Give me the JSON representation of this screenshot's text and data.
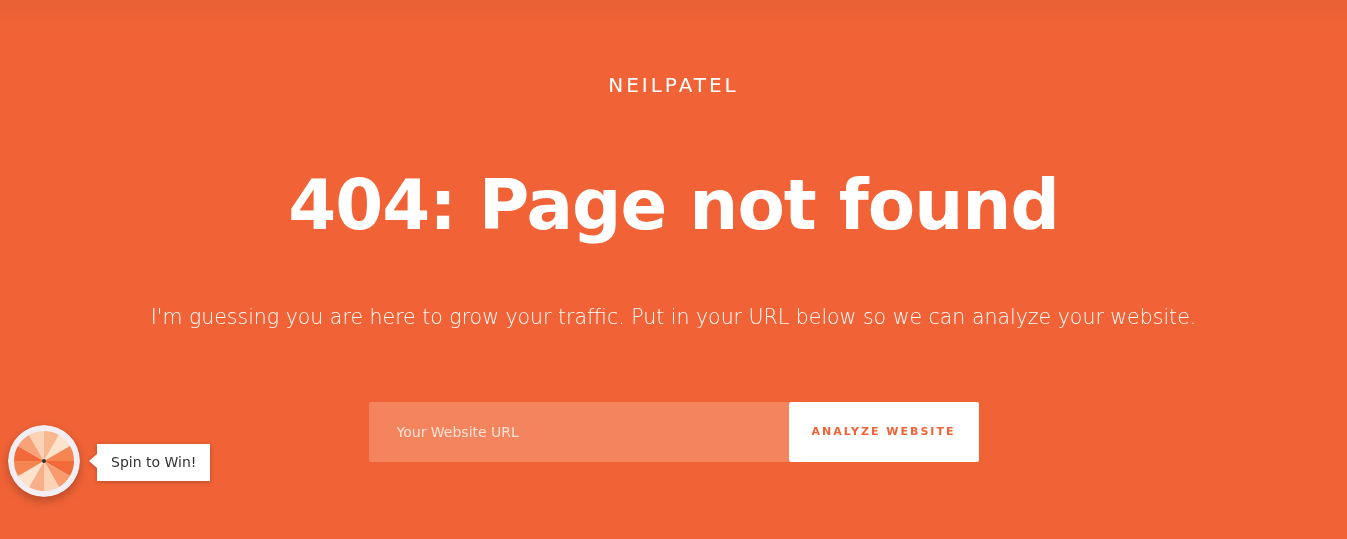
{
  "logo": "NEILPATEL",
  "heading": "404: Page not found",
  "subtitle": "I'm guessing you are here to grow your traffic. Put in your URL below so we can analyze your website.",
  "url_form": {
    "placeholder": "Your Website URL",
    "button": "ANALYZE WEBSITE"
  },
  "spin_widget": {
    "label": "Spin to Win!"
  }
}
